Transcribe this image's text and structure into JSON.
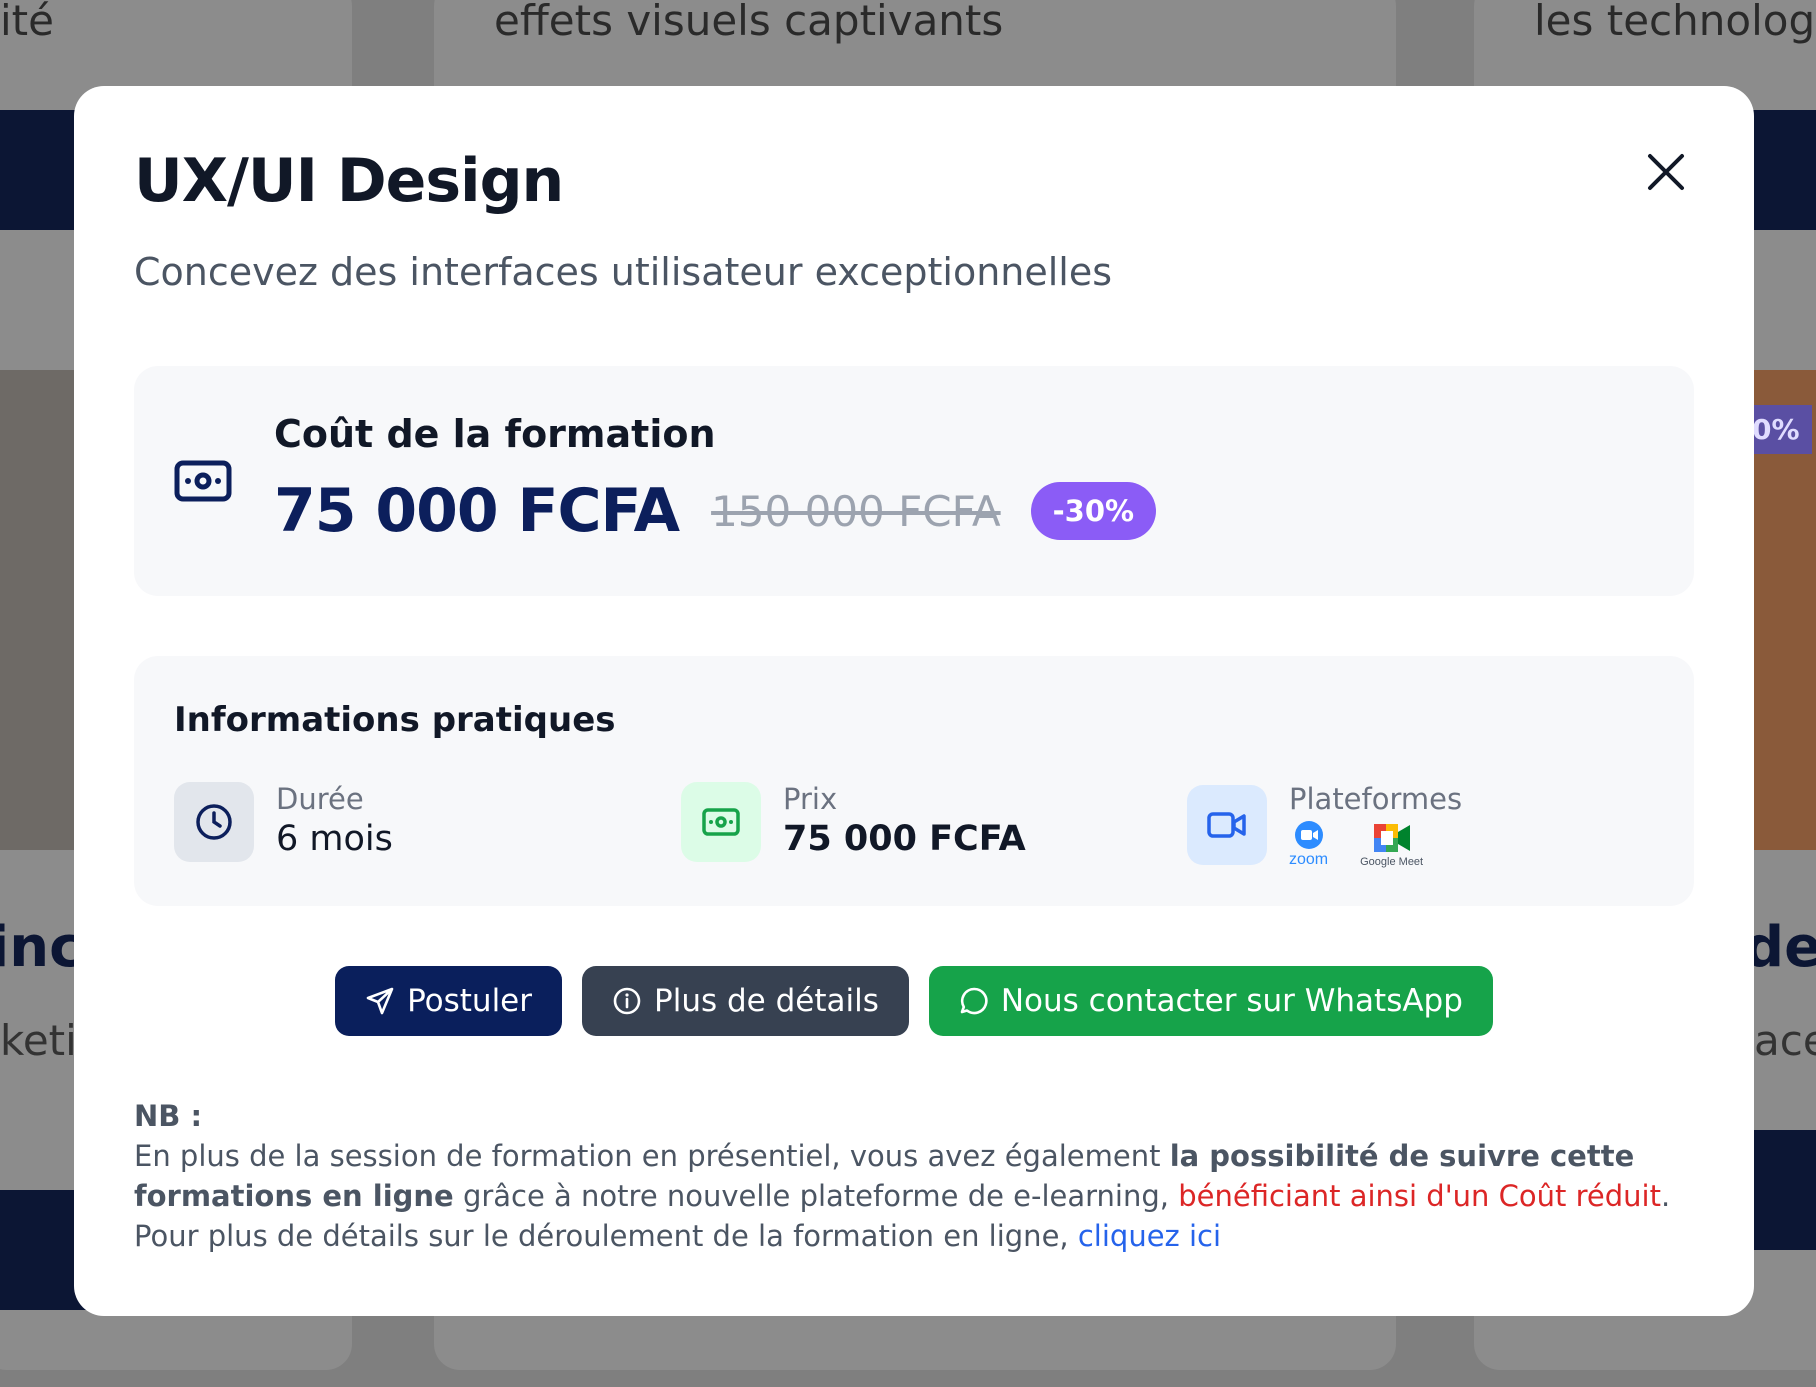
{
  "background": {
    "card_snippets": [
      "ité",
      "effets visuels captivants",
      "les technologi"
    ],
    "left_heading": "inc",
    "left_sub": "keti",
    "right_heading": "de",
    "right_sub": "ace",
    "right_badge": "0%"
  },
  "modal": {
    "title": "UX/UI Design",
    "subtitle": "Concevez des interfaces utilisateur exceptionnelles",
    "close_icon": "close-icon"
  },
  "cost": {
    "label": "Coût de la formation",
    "price": "75 000 FCFA",
    "old_price": "150 000 FCFA",
    "discount": "-30%",
    "icon": "money-icon"
  },
  "info": {
    "title": "Informations pratiques",
    "items": [
      {
        "label": "Durée",
        "value": "6 mois",
        "icon": "clock-icon"
      },
      {
        "label": "Prix",
        "value": "75 000 FCFA",
        "icon": "money-icon"
      },
      {
        "label": "Plateformes",
        "icon": "video-camera-icon",
        "logos": [
          "zoom",
          "Google Meet"
        ]
      }
    ]
  },
  "actions": {
    "apply": "Postuler",
    "details": "Plus de détails",
    "whatsapp": "Nous contacter sur WhatsApp"
  },
  "note": {
    "title": "NB :",
    "part1": "En plus de la session de formation en présentiel, vous avez également ",
    "bold": "la possibilité de suivre cette formations en ligne",
    "part2": " grâce à notre nouvelle plateforme de e-learning, ",
    "red": "bénéficiant ainsi d'un Coût réduit",
    "part3": ". Pour plus de détails sur le déroulement de la formation en ligne, ",
    "link": "cliquez ici"
  },
  "colors": {
    "navy": "#0a1f5c",
    "slate": "#374151",
    "whatsapp_green": "#16a34a",
    "badge_purple": "#8b5cf6",
    "red": "#dc2626",
    "link_blue": "#2563eb"
  }
}
